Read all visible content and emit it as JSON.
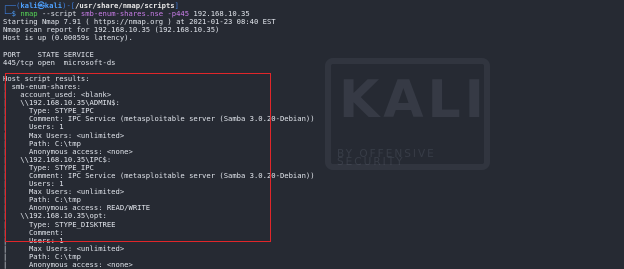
{
  "prompt": {
    "frame_top": "┌──(",
    "user": "kali㉿kali",
    "mid": ")-[",
    "path": "/usr/share/nmap/scripts",
    "end": "]",
    "frame_bottom": "└─",
    "dollar": "$ ",
    "command": "nmap",
    "opt_script": " --script ",
    "script_name": "smb-enum-shares.nse",
    "opt_port": " -p445 ",
    "target": "192.168.10.35"
  },
  "output_lines": [
    "Starting Nmap 7.91 ( https://nmap.org ) at 2021-01-23 08:40 EST",
    "Nmap scan report for 192.168.10.35 (192.168.10.35)",
    "Host is up (0.00059s latency).",
    "",
    "PORT    STATE SERVICE",
    "445/tcp open  microsoft-ds",
    "",
    "Host script results:",
    "| smb-enum-shares:",
    "|   account_used: <blank>",
    "|   \\\\192.168.10.35\\ADMIN$:",
    "|     Type: STYPE_IPC",
    "|     Comment: IPC Service (metasploitable server (Samba 3.0.20-Debian))",
    "|     Users: 1",
    "|     Max Users: <unlimited>",
    "|     Path: C:\\tmp",
    "|     Anonymous access: <none>",
    "|   \\\\192.168.10.35\\IPC$:",
    "|     Type: STYPE_IPC",
    "|     Comment: IPC Service (metasploitable server (Samba 3.0.20-Debian))",
    "|     Users: 1",
    "|     Max Users: <unlimited>",
    "|     Path: C:\\tmp",
    "|     Anonymous access: READ/WRITE",
    "|   \\\\192.168.10.35\\opt:",
    "|     Type: STYPE_DISKTREE",
    "|     Comment:",
    "|     Users: 1",
    "|     Max Users: <unlimited>",
    "|     Path: C:\\tmp",
    "|     Anonymous access: <none>"
  ],
  "watermark": {
    "logo_text": "KALI",
    "tagline": "BY OFFENSIVE SECURITY"
  },
  "colors": {
    "background": "#262a33",
    "highlight_border": "#e0262a",
    "prompt_blue": "#4ea1ff",
    "command_green": "#54d354",
    "argument_purple": "#c97de8"
  }
}
